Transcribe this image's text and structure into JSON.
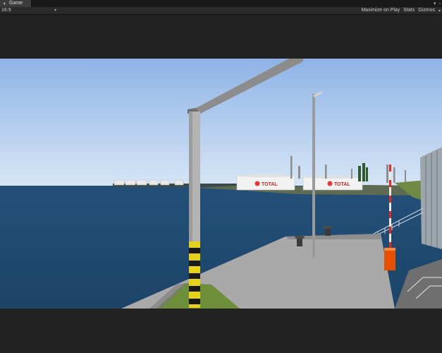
{
  "window": {
    "tab_label": "Game",
    "tab_icon": "game-view-icon",
    "menu_icon": "context-menu-icon",
    "maximize_icon": "maximize-icon"
  },
  "toolbar": {
    "aspect_label": "16:9",
    "maximize_on_play": "Maximize on Play",
    "stats": "Stats",
    "gizmos": "Gizmos"
  },
  "scene": {
    "brand_left": "TOTAL",
    "brand_right": "TOTAL",
    "colors": {
      "sky_top": "#8fb3e6",
      "sky_horizon": "#d6e6f6",
      "sea": "#1e4a72",
      "pier": "#a8a8a8",
      "grass": "#6d8f3a"
    }
  }
}
